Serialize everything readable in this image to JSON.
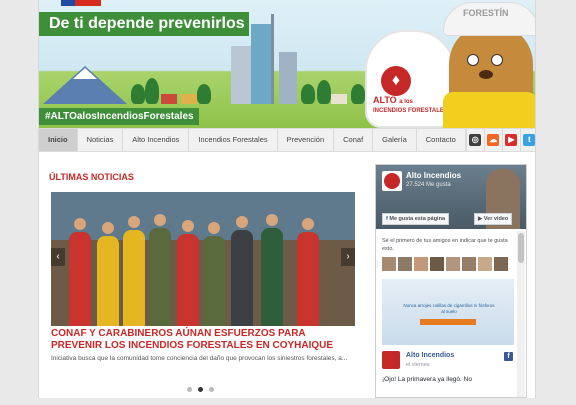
{
  "banner": {
    "slogan": "De ti depende prevenirlos",
    "hashtag": "#ALTOalosIncendiosForestales",
    "mascot_helmet": "FORESTÍN",
    "campaign_big": "ALTO",
    "campaign_small": "a los",
    "campaign_line2": "INCENDIOS FORESTALES"
  },
  "nav": {
    "items": [
      "Inicio",
      "Noticias",
      "Alto Incendios",
      "Incendios Forestales",
      "Prevención",
      "Conaf",
      "Galería",
      "Contacto"
    ],
    "active": "Inicio",
    "social_icons": [
      {
        "name": "instagram-icon",
        "color": "#3f3f3f"
      },
      {
        "name": "soundcloud-icon",
        "color": "#f26522"
      },
      {
        "name": "youtube-icon",
        "color": "#d92c2c"
      },
      {
        "name": "twitter-icon",
        "color": "#3aa1e0"
      },
      {
        "name": "facebook-icon",
        "color": "#3b5998"
      }
    ]
  },
  "news": {
    "section_title": "ÚLTIMAS NOTICIAS",
    "headline": "CONAF Y CARABINEROS AÚNAN ESFUERZOS PARA PREVENIR LOS INCENDIOS FORESTALES EN COYHAIQUE",
    "excerpt": "Iniciativa busca que la comunidad tome conciencia del daño que provocan los siniestros forestales, a...",
    "prev_arrow": "‹",
    "next_arrow": "›",
    "slide_count": 3,
    "active_slide": 2
  },
  "facebook": {
    "page_name": "Alto Incendios",
    "likes": "27.524 Me gusta",
    "like_button": "Me gusta esta página",
    "video_button": "Ver video",
    "friends_text": "Sé el primero de tus amigos en indicar que te gusta esto.",
    "ad_text": "Nunca arrojes colillas de cigarrillos ni fósforos al suelo",
    "post_author": "Alto Incendios",
    "post_date": "el viernes",
    "post_text": "¡Ojo! La primavera ya llegó. No"
  },
  "colors": {
    "brand_red": "#c62828",
    "brand_green": "#3e8e3a",
    "fb_blue": "#3b5998"
  }
}
